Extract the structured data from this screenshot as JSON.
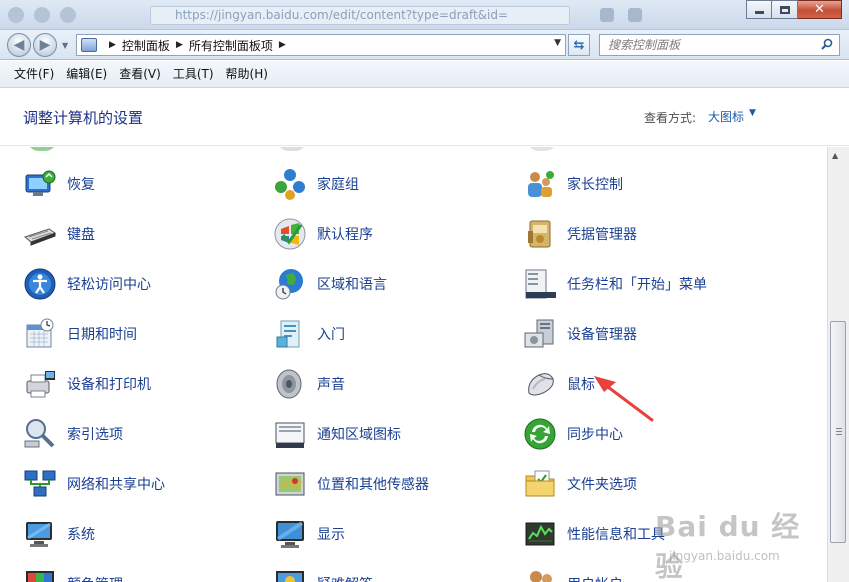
{
  "browser": {
    "url_fragment": "https://jingyan.baidu.com/edit/content?type=draft&id="
  },
  "address_bar": {
    "crumbs": [
      "控制面板",
      "所有控制面板项"
    ]
  },
  "search": {
    "placeholder": "搜索控制面板"
  },
  "menu": {
    "items": [
      "文件(F)",
      "编辑(E)",
      "查看(V)",
      "工具(T)",
      "帮助(H)"
    ]
  },
  "header": {
    "title": "调整计算机的设置",
    "view_label": "查看方式:",
    "view_value": "大图标"
  },
  "items": [
    {
      "label": "恢复",
      "icon": "recovery-icon"
    },
    {
      "label": "家庭组",
      "icon": "homegroup-icon"
    },
    {
      "label": "家长控制",
      "icon": "parental-controls-icon"
    },
    {
      "label": "键盘",
      "icon": "keyboard-icon"
    },
    {
      "label": "默认程序",
      "icon": "default-programs-icon"
    },
    {
      "label": "凭据管理器",
      "icon": "credential-manager-icon"
    },
    {
      "label": "轻松访问中心",
      "icon": "ease-of-access-icon"
    },
    {
      "label": "区域和语言",
      "icon": "region-language-icon"
    },
    {
      "label": "任务栏和「开始」菜单",
      "icon": "taskbar-start-icon"
    },
    {
      "label": "日期和时间",
      "icon": "date-time-icon"
    },
    {
      "label": "入门",
      "icon": "getting-started-icon"
    },
    {
      "label": "设备管理器",
      "icon": "device-manager-icon"
    },
    {
      "label": "设备和打印机",
      "icon": "devices-printers-icon"
    },
    {
      "label": "声音",
      "icon": "sound-icon"
    },
    {
      "label": "鼠标",
      "icon": "mouse-icon"
    },
    {
      "label": "索引选项",
      "icon": "indexing-options-icon"
    },
    {
      "label": "通知区域图标",
      "icon": "notification-area-icon"
    },
    {
      "label": "同步中心",
      "icon": "sync-center-icon"
    },
    {
      "label": "网络和共享中心",
      "icon": "network-sharing-icon"
    },
    {
      "label": "位置和其他传感器",
      "icon": "location-sensors-icon"
    },
    {
      "label": "文件夹选项",
      "icon": "folder-options-icon"
    },
    {
      "label": "系统",
      "icon": "system-icon"
    },
    {
      "label": "显示",
      "icon": "display-icon"
    },
    {
      "label": "性能信息和工具",
      "icon": "performance-icon"
    },
    {
      "label": "颜色管理",
      "icon": "color-management-icon"
    },
    {
      "label": "疑难解答",
      "icon": "troubleshooting-icon"
    },
    {
      "label": "用户帐户",
      "icon": "user-accounts-icon"
    }
  ],
  "watermark": {
    "logo": "Bai du 经验",
    "url": "jingyan.baidu.com"
  },
  "colors": {
    "link": "#1a3f93",
    "title": "#1e3287",
    "arrow": "#e8403a"
  }
}
